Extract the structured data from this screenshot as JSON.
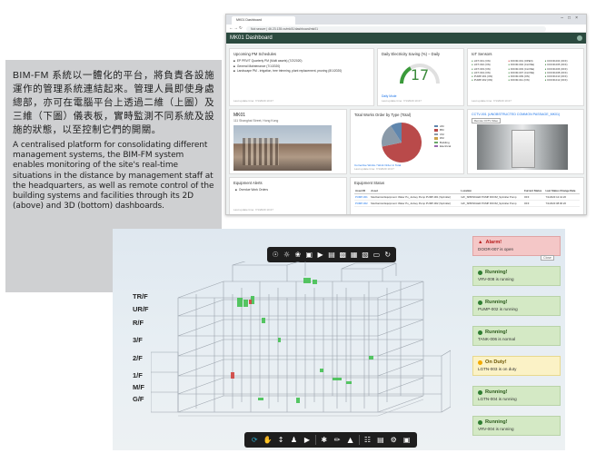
{
  "caption": {
    "zh": "BIM-FM 系統以一體化的平台，將負責各設施運作的管理系統連結起來。管理人員即使身處總部，亦可在電腦平台上透過二維（上圖）及三維（下圖）儀表板，實時監測不同系統及設施的狀態，以至控制它們的開關。",
    "en": "A centralised platform for consolidating different management systems, the BIM-FM system enables monitoring of the site's real-time situations in the distance by management staff at the headquarters, as well as remote control of the building systems and facilities through its 2D (above) and 3D (bottom) dashboards."
  },
  "browser": {
    "tab_title": "MK01 Dashboard",
    "url": "Not secure | 46.23.135.xx/mk01/dashboard/mk01",
    "app_title": "MK01 Dashboard"
  },
  "dashboard": {
    "pm": {
      "title": "Upcoming PM Schedules",
      "items": [
        "EP PRV/T Quarterly PM (Multi assets) (7/2/2020)",
        "General Maintenance (7/1/2020)",
        "Landscape PM - irrigation, tree trimming, plant replacement, pruning (8/1/2020)"
      ],
      "footer": "Last update time: 7/1/2020 10:27"
    },
    "electricity": {
      "title": "Daily Electricity Saving (%) – Daily",
      "value": "17",
      "link": "Daily Mode",
      "footer": "Last update time: 7/1/2020 10:27"
    },
    "iot": {
      "title": "IoT Sensors",
      "items": [
        {
          "label": "LIFT-001 (ON)",
          "warn": false
        },
        {
          "label": "DOOR-001 (OPEN)",
          "warn": true
        },
        {
          "label": "DOOR-004 (OFF)",
          "warn": false
        },
        {
          "label": "LIFT-002 (ON)",
          "warn": false
        },
        {
          "label": "DOOR-002 (CLOSE)",
          "warn": false
        },
        {
          "label": "DOOR-005 (OFF)",
          "warn": false
        },
        {
          "label": "LIFT-003 (ON)",
          "warn": false
        },
        {
          "label": "DOOR-003 (CLOSE)",
          "warn": false
        },
        {
          "label": "DOOR-006 (OFF)",
          "warn": false
        },
        {
          "label": "LIFT-004 (ON)",
          "warn": false
        },
        {
          "label": "DOOR-007 (CLOSE)",
          "warn": false
        },
        {
          "label": "DOOR-008 (OFF)",
          "warn": false
        },
        {
          "label": "PUMP-001 (ON)",
          "warn": false
        },
        {
          "label": "DOOR-009 (ON)",
          "warn": false
        },
        {
          "label": "DOOR-010 (OFF)",
          "warn": false
        },
        {
          "label": "PUMP-002 (ON)",
          "warn": false
        },
        {
          "label": "DOOR-011 (ON)",
          "warn": false
        },
        {
          "label": "DOOR-012 (OFF)",
          "warn": false
        }
      ],
      "footer": "Last update time: 7/1/2020 10:27"
    },
    "site": {
      "title": "MK01",
      "address": "111 Shanghai Street, Hong Kong"
    },
    "workorders": {
      "title": "Total Works Order by Type (Total)",
      "legend": [
        "AM",
        "BM",
        "CM",
        "DM",
        "Building",
        "Electrical"
      ],
      "footer_a": "Corrective Works / Work Order in Total",
      "footer_b": "Last update time: 7/1/2020 10:27"
    },
    "cctv": {
      "link": "CCTV-001",
      "title": "CCTV-001 (UNOBSTRUCTED COMMON PASSAGE_MK01)",
      "button": "Remote CCTV Video"
    },
    "equipment_alerts": {
      "title": "Equipment Alerts",
      "subtitle": "Overdue Work Orders",
      "footer": "Last update time: 7/1/2020 10:27"
    },
    "equipment_status": {
      "title": "Equipment Status",
      "columns": [
        "Asset ID",
        "Asset",
        "Location",
        "Current Status",
        "Last Status Change Date"
      ],
      "rows": [
        [
          "PUMP-001",
          "Mechanical Equipment: Water Pu_Jockey Pump PUMP-001 (Sprinkler)",
          "G/F_SPRINKLER PUMP ROOM_Sprinkler Pump",
          "OFF",
          "7/1/2020 12:41:20"
        ],
        [
          "PUMP-002",
          "Mechanical Equipment: Water Pu_Jockey Pump PUMP-002 (Sprinkler)",
          "G/F_SPRINKLER PUMP ROOM_Sprinkler Pump",
          "OFF",
          "7/1/2020 08:00:20"
        ]
      ]
    }
  },
  "view3d": {
    "floors": [
      "TR/F",
      "UR/F",
      "R/F",
      "3/F",
      "2/F",
      "1/F",
      "M/F",
      "G/F"
    ],
    "alerts": [
      {
        "kind": "red",
        "title": "Alarm!",
        "message": "DOOR-007 is open",
        "close": "Close"
      },
      {
        "kind": "green",
        "title": "Running!",
        "message": "VRV-008 is running"
      },
      {
        "kind": "green",
        "title": "Running!",
        "message": "PUMP-002 is running"
      },
      {
        "kind": "green",
        "title": "Running!",
        "message": "TANK-006 is normal"
      },
      {
        "kind": "yellow",
        "title": "On Duty!",
        "message": "LGTN-003 is on duty"
      },
      {
        "kind": "green",
        "title": "Running!",
        "message": "LGTN-004 is running"
      },
      {
        "kind": "green",
        "title": "Running!",
        "message": "VRV-004 is running"
      }
    ],
    "toolbar_top_icons": [
      "sensor-icon",
      "bulb-icon",
      "fan-icon",
      "screen-icon",
      "camera-icon",
      "document-icon",
      "document-icon",
      "document-icon",
      "document-icon",
      "trash-icon",
      "refresh-icon"
    ],
    "toolbar_bottom_icons": [
      "orbit-icon",
      "pan-icon",
      "move-icon",
      "walk-icon",
      "camera-icon",
      "explode-icon",
      "measure-icon",
      "section-icon",
      "tree-icon",
      "properties-icon",
      "settings-icon",
      "fullscreen-icon"
    ],
    "colors": {
      "active": "#2aa7c7",
      "toolbar": "#1e1e1e",
      "equipment": "#3cbf4a"
    }
  }
}
